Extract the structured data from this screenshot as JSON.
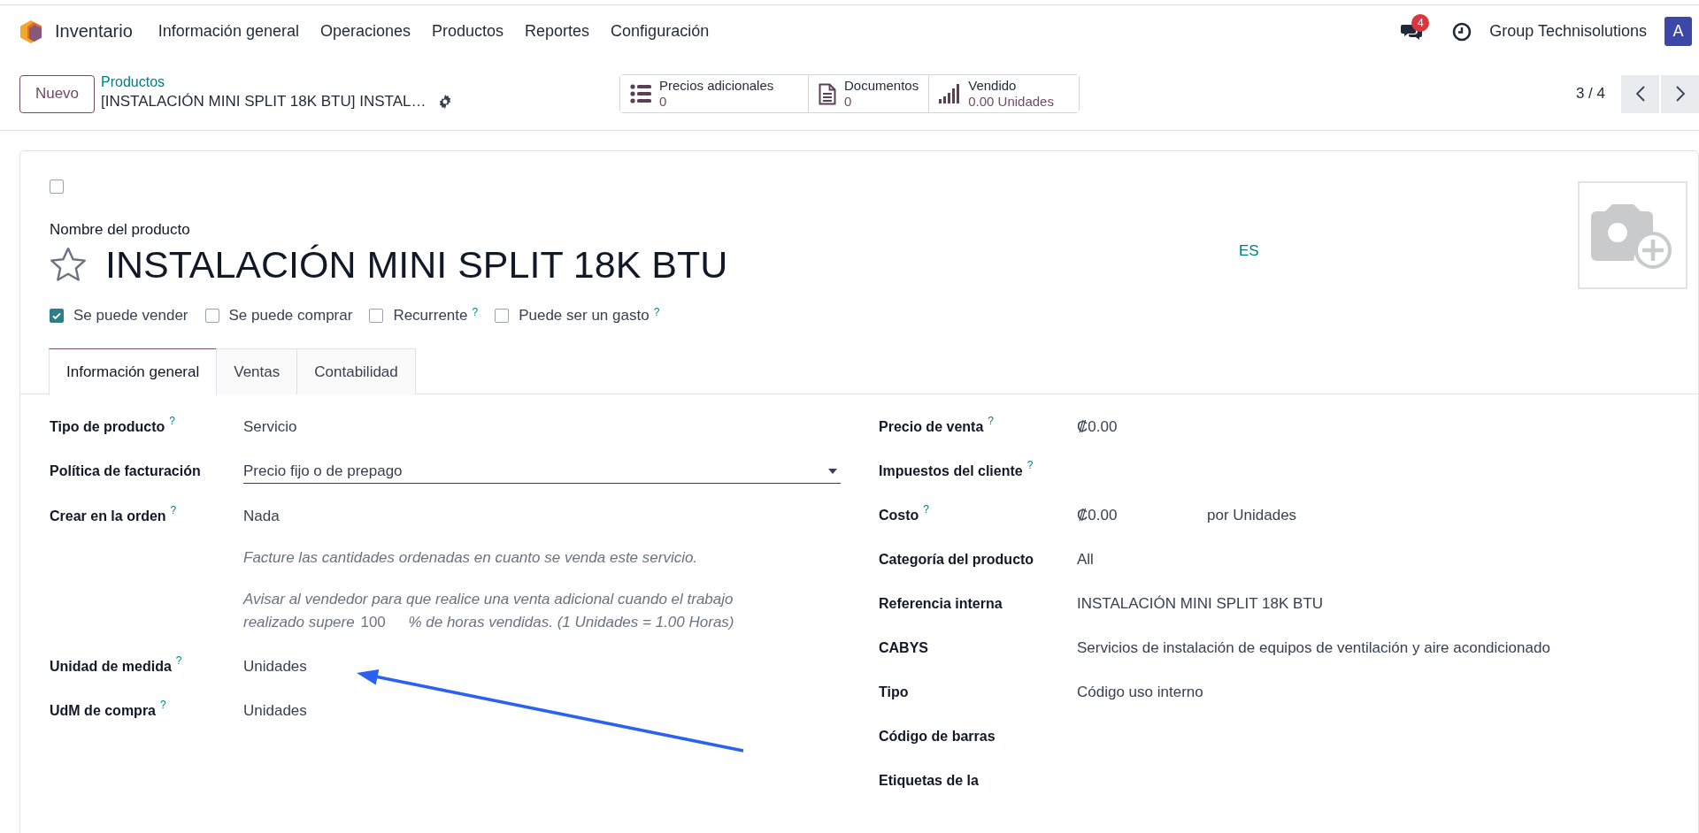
{
  "navbar": {
    "app_name": "Inventario",
    "menu": [
      "Información general",
      "Operaciones",
      "Productos",
      "Reportes",
      "Configuración"
    ],
    "messages_badge": "4",
    "company": "Group Technisolutions",
    "avatar": "A"
  },
  "control_panel": {
    "new_button": "Nuevo",
    "breadcrumb": "Productos",
    "record_title": "[INSTALACIÓN MINI SPLIT 18K BTU] INSTAL…",
    "stat_buttons": [
      {
        "kind": "pricelist",
        "label": "Precios adicionales",
        "value": "0"
      },
      {
        "kind": "documents",
        "label": "Documentos",
        "value": "0"
      },
      {
        "kind": "sold",
        "label": "Vendido",
        "value": "0.00 Unidades"
      }
    ],
    "pager": "3 / 4"
  },
  "form": {
    "selector_checkbox": {
      "checked": false
    },
    "name_label": "Nombre del producto",
    "name": "INSTALACIÓN MINI SPLIT 18K BTU",
    "favorite": false,
    "language": "ES",
    "options": [
      {
        "label": "Se puede vender",
        "checked": true
      },
      {
        "label": "Se puede comprar",
        "checked": false
      },
      {
        "label": "Recurrente",
        "checked": false,
        "help": "?"
      },
      {
        "label": "Puede ser un gasto",
        "checked": false,
        "help": "?"
      }
    ],
    "tabs": [
      {
        "label": "Información general",
        "selected": true
      },
      {
        "label": "Ventas",
        "selected": false
      },
      {
        "label": "Contabilidad",
        "selected": false
      }
    ],
    "left_fields": [
      {
        "kind": "text",
        "label": "Tipo de producto",
        "help": "?",
        "value": "Servicio"
      },
      {
        "kind": "select",
        "label": "Política de facturación",
        "value": "Precio fijo o de prepago"
      },
      {
        "kind": "text",
        "label": "Crear en la orden",
        "help": "?",
        "value": "Nada"
      },
      {
        "kind": "note",
        "text": "Facture las cantidades ordenadas en cuanto se venda este servicio."
      },
      {
        "kind": "note_input",
        "lead": "Avisar al vendedor para que realice una venta adicional cuando el trabajo",
        "before": "realizado supere",
        "input": "100",
        "after": "% de horas vendidas. (1 Unidades = 1.00 Horas)"
      },
      {
        "kind": "text",
        "label": "Unidad de medida",
        "help": "?",
        "value": "Unidades"
      },
      {
        "kind": "text",
        "label": "UdM de compra",
        "help": "?",
        "value": "Unidades"
      }
    ],
    "right_fields": [
      {
        "kind": "text",
        "label": "Precio de venta",
        "help": "?",
        "value": "₡0.00"
      },
      {
        "kind": "text",
        "label": "Impuestos del cliente",
        "help": "?"
      },
      {
        "kind": "cost",
        "label": "Costo",
        "help": "?",
        "value": "₡0.00",
        "unit": "por Unidades"
      },
      {
        "kind": "text",
        "label": "Categoría del producto",
        "value": "All"
      },
      {
        "kind": "text",
        "label": "Referencia interna",
        "value": "INSTALACIÓN MINI SPLIT 18K BTU"
      },
      {
        "kind": "text",
        "label": "CABYS",
        "value": "Servicios de instalación de equipos de ventilación y aire acondicionado"
      },
      {
        "kind": "text",
        "label": "Tipo",
        "value": "Código uso interno"
      },
      {
        "kind": "text",
        "label": "Código de barras"
      },
      {
        "kind": "text",
        "label": "Etiquetas de la"
      }
    ]
  }
}
